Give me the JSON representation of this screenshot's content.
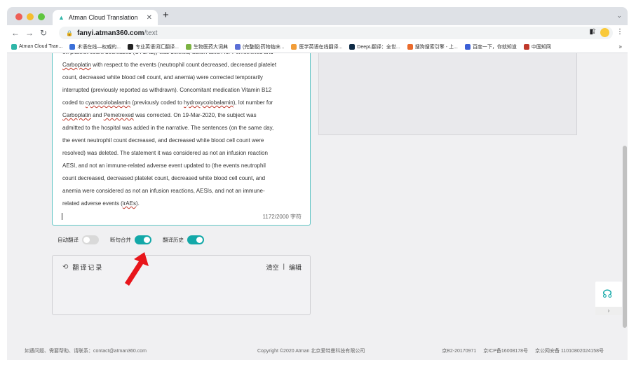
{
  "browser": {
    "tab_title": "Atman Cloud Translation",
    "new_tab": "+",
    "url_host": "fanyi.atman360.com",
    "url_path": "/text",
    "bookmarks": [
      {
        "label": "Atman Cloud Tran...",
        "color": "#2fb6a8"
      },
      {
        "label": "术语在线—权威的...",
        "color": "#3a6fd8"
      },
      {
        "label": "专业英语词汇翻译...",
        "color": "#222222"
      },
      {
        "label": "生物医药大词典",
        "color": "#7cb342"
      },
      {
        "label": "(完整版)药物临床...",
        "color": "#5b6fd6"
      },
      {
        "label": "医学英语在线翻译...",
        "color": "#f29d38"
      },
      {
        "label": "DeepL翻译：全世...",
        "color": "#0f2b46"
      },
      {
        "label": "搜狗搜索引擎 - 上...",
        "color": "#ea6b2c"
      },
      {
        "label": "百度一下，你就知道",
        "color": "#3b5fd6"
      },
      {
        "label": "中国知网",
        "color": "#c0392b"
      }
    ],
    "bookmarks_more": "»"
  },
  "source_text": {
    "line0": "on platelet count decreased (CTCAE)) was deleted, action taken for Pemetrexed and",
    "line1_u": "Carboplatin",
    "line1": " with respect to the events (neutrophil count decreased, decreased platelet",
    "line2": "count, decreased white blood cell count, and anemia) were corrected temporarily",
    "line3": "interrupted (previously reported as withdrawn). Concomitant medication Vitamin B12",
    "line4a": "coded to ",
    "line4_u1": "cyanocolobalamin",
    "line4b": " (previously coded to ",
    "line4_u2": "hydroxycolobalamin",
    "line4c": "), lot number for",
    "line5_u1": "Carboplatin",
    "line5a": " and ",
    "line5_u2": "Pemetrexed",
    "line5b": " was corrected. On 19-Mar-2020, the subject was",
    "line6": "admitted to the hospital was added in the narrative. The sentences (on the same day,",
    "line7": "the event neutrophil count decreased, and decreased white blood cell count were",
    "line8": "resolved) was deleted. The statement it was considered as not an infusion reaction",
    "line9": "AESI, and not an immune-related adverse event updated to (the events neutrophil",
    "line10": "count decreased, decreased platelet count, decreased white blood cell count, and",
    "line11": "anemia were considered as not an infusion reactions, AESIs, and not an immune-",
    "line12a": "related adverse events (",
    "line12_u": "irAEs",
    "line12b": ").",
    "counter": "1172/2000 字符"
  },
  "toggles": {
    "auto_translate": {
      "label": "自动翻译",
      "on": false
    },
    "sentence_merge": {
      "label": "断句合并",
      "on": true
    },
    "history": {
      "label": "翻译历史",
      "on": true
    }
  },
  "history_panel": {
    "title": "翻译记录",
    "clear": "清空",
    "separator": "|",
    "edit": "编辑"
  },
  "support": {
    "icon": "headset-icon",
    "more": "›"
  },
  "footer": {
    "contact": "如遇问题、需要帮助、请联系：contact@atman360.com",
    "copyright": "Copyright ©2020 Atman   北京爱特曼科技有限公司",
    "icp1": "京B2-20170971",
    "icp2": "京ICP备16008178号",
    "police": "京公网安备 11010802024158号"
  },
  "colors": {
    "accent": "#13a8a8",
    "annotation_arrow": "#e8161b"
  }
}
